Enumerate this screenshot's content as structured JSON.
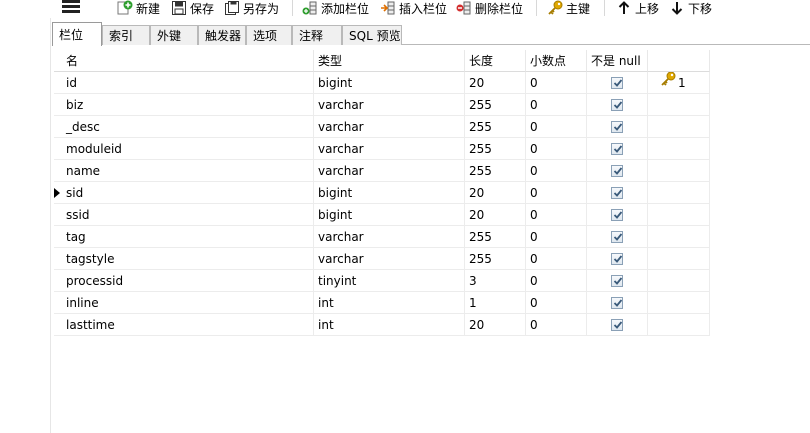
{
  "toolbar": {
    "new_label": "新建",
    "save_label": "保存",
    "save_as_label": "另存为",
    "add_column_label": "添加栏位",
    "insert_column_label": "插入栏位",
    "delete_column_label": "删除栏位",
    "primary_key_label": "主键",
    "move_up_label": "上移",
    "move_down_label": "下移"
  },
  "tabs": [
    "栏位",
    "索引",
    "外键",
    "触发器",
    "选项",
    "注释",
    "SQL 预览"
  ],
  "active_tab": "栏位",
  "grid": {
    "headers": [
      "名",
      "类型",
      "长度",
      "小数点",
      "不是 null",
      ""
    ],
    "rows": [
      {
        "name": "id",
        "type": "bigint",
        "length": "20",
        "decimals": "0",
        "not_null": true,
        "key": "1"
      },
      {
        "name": "biz",
        "type": "varchar",
        "length": "255",
        "decimals": "0",
        "not_null": true,
        "key": ""
      },
      {
        "name": "_desc",
        "type": "varchar",
        "length": "255",
        "decimals": "0",
        "not_null": true,
        "key": ""
      },
      {
        "name": "moduleid",
        "type": "varchar",
        "length": "255",
        "decimals": "0",
        "not_null": true,
        "key": ""
      },
      {
        "name": "name",
        "type": "varchar",
        "length": "255",
        "decimals": "0",
        "not_null": true,
        "key": ""
      },
      {
        "name": "sid",
        "type": "bigint",
        "length": "20",
        "decimals": "0",
        "not_null": true,
        "key": ""
      },
      {
        "name": "ssid",
        "type": "bigint",
        "length": "20",
        "decimals": "0",
        "not_null": true,
        "key": ""
      },
      {
        "name": "tag",
        "type": "varchar",
        "length": "255",
        "decimals": "0",
        "not_null": true,
        "key": ""
      },
      {
        "name": "tagstyle",
        "type": "varchar",
        "length": "255",
        "decimals": "0",
        "not_null": true,
        "key": ""
      },
      {
        "name": "processid",
        "type": "tinyint",
        "length": "3",
        "decimals": "0",
        "not_null": true,
        "key": ""
      },
      {
        "name": "inline",
        "type": "int",
        "length": "1",
        "decimals": "0",
        "not_null": true,
        "key": ""
      },
      {
        "name": "lasttime",
        "type": "int",
        "length": "20",
        "decimals": "0",
        "not_null": true,
        "key": ""
      }
    ],
    "current_row": "sid"
  },
  "colors": {
    "key_gold": "#e0a800",
    "check_mark": "#3a5a7a",
    "add_green": "#2e9e2e",
    "delete_red": "#d32f2f"
  },
  "icons": {
    "menu": "hamburger-menu-icon",
    "new": "new-plus-icon",
    "save": "save-disk-icon",
    "save_as": "save-as-icon",
    "add_column": "add-column-icon",
    "insert_column": "insert-column-icon",
    "delete_column": "delete-column-icon",
    "primary_key": "key-icon",
    "move_up": "arrow-up-icon",
    "move_down": "arrow-down-icon"
  }
}
